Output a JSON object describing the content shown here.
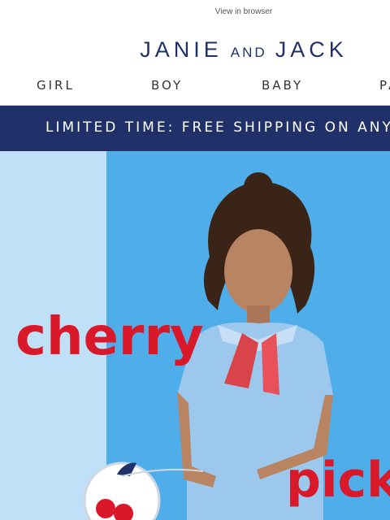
{
  "header": {
    "view_in_browser": "View in browser",
    "logo": {
      "part1": "JANIE",
      "part2": "AND",
      "part3": "JACK",
      "color": "#1f3168"
    }
  },
  "nav": {
    "items": [
      "GIRL",
      "BOY",
      "BABY",
      "PA"
    ]
  },
  "promo": {
    "text": "LIMITED TIME: FREE SHIPPING ON ANY O",
    "background": "#1f3168"
  },
  "hero": {
    "word1": "cherry",
    "word2": "pick",
    "accent_color": "#d9182a",
    "colors": {
      "left_panel": "#bfe0f6",
      "wall": "#4faeea",
      "outfit": "#9cc8ee"
    }
  }
}
